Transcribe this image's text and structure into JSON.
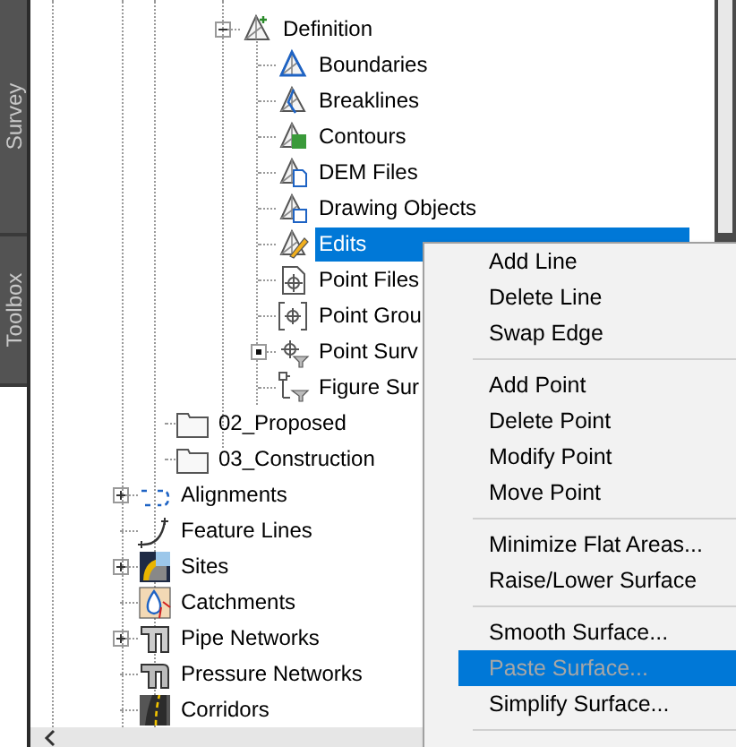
{
  "side_tabs": [
    {
      "label": "Survey"
    },
    {
      "label": "Toolbox"
    }
  ],
  "tree": {
    "label": "Definition",
    "expanded": true,
    "children": [
      {
        "label": "Boundaries",
        "selected": false
      },
      {
        "label": "Breaklines",
        "selected": false
      },
      {
        "label": "Contours",
        "selected": false
      },
      {
        "label": "DEM Files",
        "selected": false
      },
      {
        "label": "Drawing Objects",
        "selected": false
      },
      {
        "label": "Edits",
        "selected": true
      },
      {
        "label": "Point Files",
        "selected": false
      },
      {
        "label": "Point Grou",
        "selected": false
      },
      {
        "label": "Point Surv",
        "selected": false,
        "expanded": false
      },
      {
        "label": "Figure Sur",
        "selected": false
      }
    ]
  },
  "folders": [
    {
      "label": "02_Proposed"
    },
    {
      "label": "03_Construction"
    }
  ],
  "collections": [
    {
      "label": "Alignments",
      "expanded": false
    },
    {
      "label": "Feature Lines"
    },
    {
      "label": "Sites",
      "expanded": false
    },
    {
      "label": "Catchments"
    },
    {
      "label": "Pipe Networks",
      "expanded": false
    },
    {
      "label": "Pressure Networks"
    },
    {
      "label": "Corridors"
    }
  ],
  "context_menu": [
    [
      {
        "label": "Add Line",
        "disabled": false,
        "selected": false
      },
      {
        "label": "Delete Line",
        "disabled": false,
        "selected": false
      },
      {
        "label": "Swap Edge",
        "disabled": false,
        "selected": false
      }
    ],
    [
      {
        "label": "Add Point",
        "disabled": false,
        "selected": false
      },
      {
        "label": "Delete Point",
        "disabled": false,
        "selected": false
      },
      {
        "label": "Modify Point",
        "disabled": false,
        "selected": false
      },
      {
        "label": "Move Point",
        "disabled": false,
        "selected": false
      }
    ],
    [
      {
        "label": "Minimize Flat Areas...",
        "disabled": false,
        "selected": false
      },
      {
        "label": "Raise/Lower Surface",
        "disabled": false,
        "selected": false
      }
    ],
    [
      {
        "label": "Smooth Surface...",
        "disabled": false,
        "selected": false
      },
      {
        "label": "Paste Surface...",
        "disabled": true,
        "selected": true
      },
      {
        "label": "Simplify Surface...",
        "disabled": false,
        "selected": false
      }
    ]
  ]
}
